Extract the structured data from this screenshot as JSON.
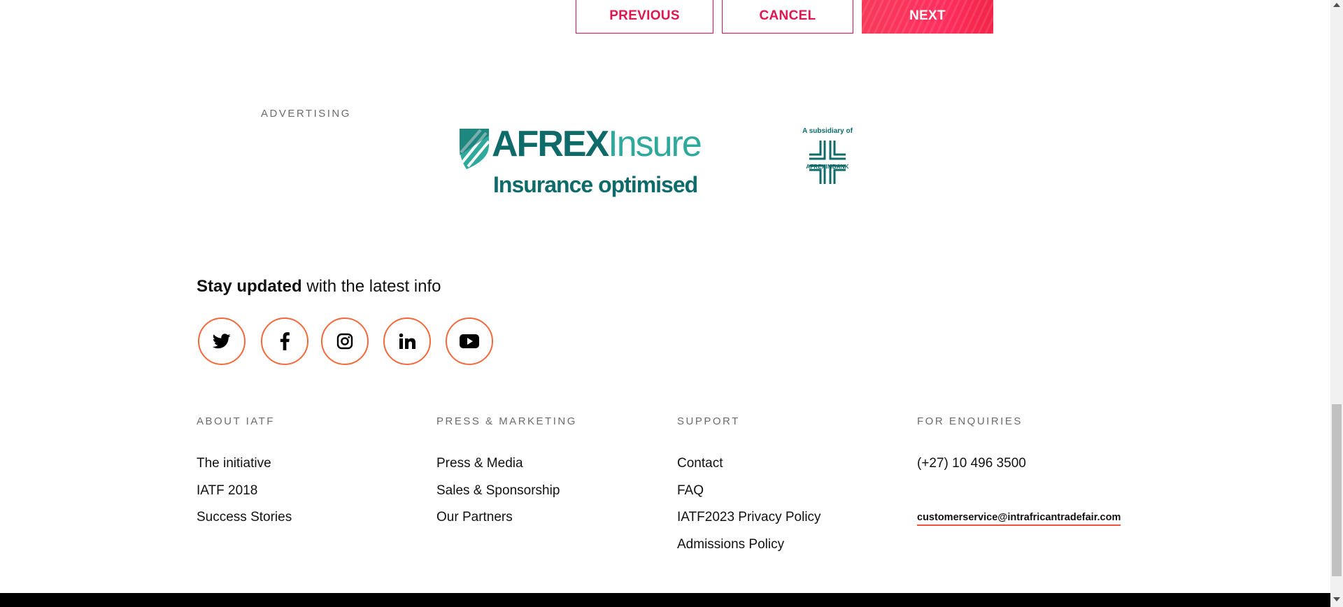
{
  "nav_buttons": {
    "previous": "PREVIOUS",
    "cancel": "CANCEL",
    "next": "NEXT"
  },
  "advertising": {
    "label": "ADVERTISING",
    "brand_part1": "AFREX",
    "brand_part2": "Insure",
    "tagline": "Insurance optimised",
    "subsidiary_text": "A subsidiary of",
    "parent_brand": "AFREXIMBANK"
  },
  "stay_updated": {
    "bold": "Stay updated",
    "rest": " with the latest info"
  },
  "social_icons": [
    "twitter-icon",
    "facebook-icon",
    "instagram-icon",
    "linkedin-icon",
    "youtube-icon"
  ],
  "footer": {
    "about": {
      "heading": "ABOUT IATF",
      "links": [
        "The initiative",
        "IATF 2018",
        "Success Stories"
      ]
    },
    "press": {
      "heading": "PRESS & MARKETING",
      "links": [
        "Press & Media",
        "Sales & Sponsorship",
        "Our Partners"
      ]
    },
    "support": {
      "heading": "SUPPORT",
      "links": [
        "Contact",
        "FAQ",
        "IATF2023 Privacy Policy",
        "Admissions Policy"
      ]
    },
    "enquiries": {
      "heading": "FOR ENQUIRIES",
      "phone": "(+27) 10 496 3500",
      "email": "customerservice@intrafricantradefair.com"
    }
  },
  "colors": {
    "accent": "#e0174f",
    "teal": "#0f6b69",
    "ring": "#f26a3c"
  }
}
